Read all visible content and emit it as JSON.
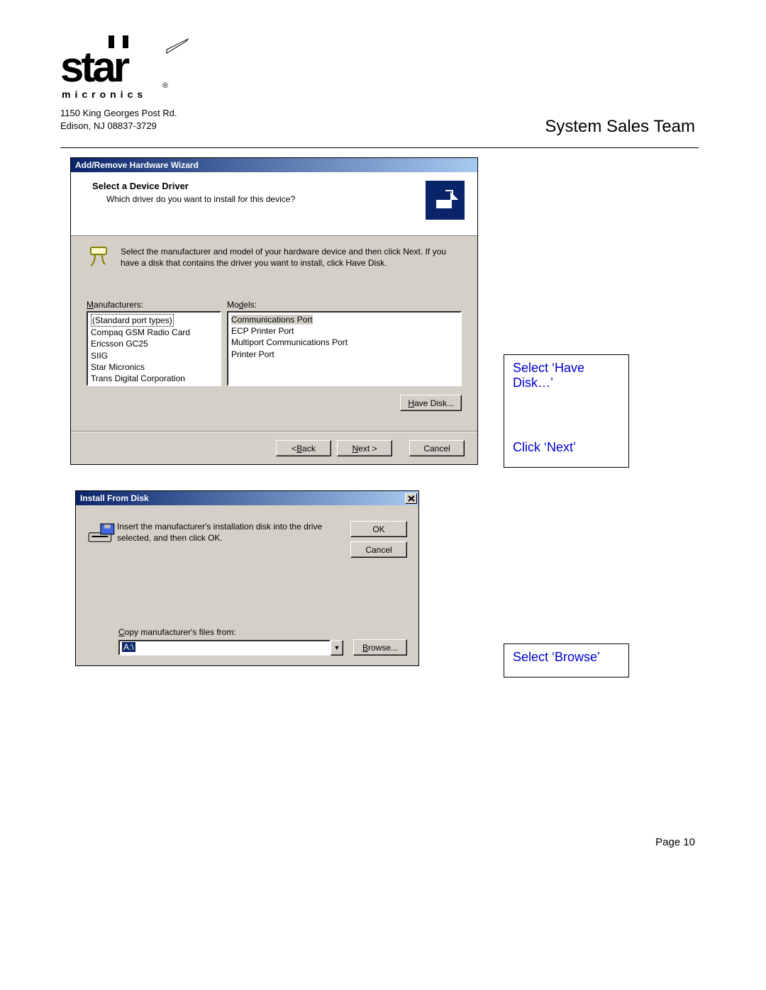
{
  "header": {
    "brand_top": "star",
    "brand_sub": "m i c r o n i c s",
    "address_line1": "1150 King Georges Post Rd.",
    "address_line2": "Edison, NJ 08837-3729",
    "team_title": "System Sales Team"
  },
  "dialog1": {
    "title": "Add/Remove Hardware Wizard",
    "heading": "Select a Device Driver",
    "subheading": "Which driver do you want to install for this device?",
    "info_text": "Select the manufacturer and model of your hardware device and then click Next. If you have a disk that contains the driver you want to install, click Have Disk.",
    "label_manufacturers": "Manufacturers:",
    "label_models": "Models:",
    "manufacturers": [
      "(Standard port types)",
      "Compaq GSM Radio Card",
      "Ericsson GC25",
      "SIIG",
      "Star Micronics",
      "Trans Digital Corporation"
    ],
    "models": [
      "Communications Port",
      "ECP Printer Port",
      "Multiport Communications Port",
      "Printer Port"
    ],
    "btn_have_disk": "Have Disk...",
    "btn_back": "< Back",
    "btn_next": "Next >",
    "btn_cancel": "Cancel"
  },
  "annotations": {
    "anno1_line1": "Select ‘Have Disk…’",
    "anno1_line2": "Click ‘Next’",
    "anno2": "Select ‘Browse’"
  },
  "dialog2": {
    "title": "Install From Disk",
    "instruction": "Insert the manufacturer's installation disk into the drive selected, and then click OK.",
    "btn_ok": "OK",
    "btn_cancel": "Cancel",
    "copy_label": "Copy manufacturer's files from:",
    "path_value": "A:\\",
    "btn_browse": "Browse..."
  },
  "footer": {
    "page_label": "Page 10"
  }
}
